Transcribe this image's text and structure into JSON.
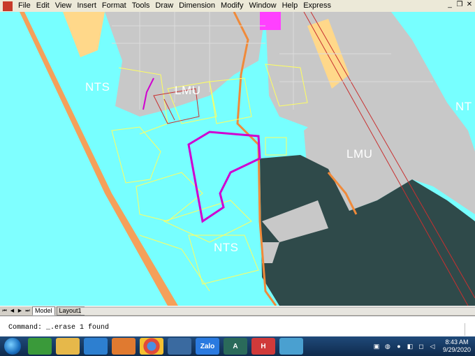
{
  "menu": {
    "items": [
      "File",
      "Edit",
      "View",
      "Insert",
      "Format",
      "Tools",
      "Draw",
      "Dimension",
      "Modify",
      "Window",
      "Help",
      "Express"
    ]
  },
  "window_controls": {
    "minimize": "_",
    "restore": "❐",
    "close": "✕"
  },
  "map": {
    "labels": [
      "NTS",
      "LMU",
      "LMU",
      "NTS",
      "NT"
    ],
    "colors": {
      "water": "#7fffff",
      "land_gray": "#c8c8c8",
      "beach_orange": "#f5a05a",
      "sand_yellow": "#ffd88a",
      "dark_zone": "#2f4a4a",
      "parcel_magenta": "#d000d0",
      "lines_yellow": "#ffff60",
      "road_red": "#c83030"
    }
  },
  "tabs": {
    "nav": [
      "⏮",
      "◀",
      "▶",
      "⏭"
    ],
    "items": [
      "Model",
      "Layout1"
    ]
  },
  "command": {
    "text": "Command: _.erase 1 found"
  },
  "taskbar": {
    "apps": [
      "",
      "",
      "",
      "",
      "",
      "",
      "Zalo",
      "A",
      "H",
      ""
    ],
    "clock_time": "8:43 AM",
    "clock_date": "9/29/2020"
  }
}
